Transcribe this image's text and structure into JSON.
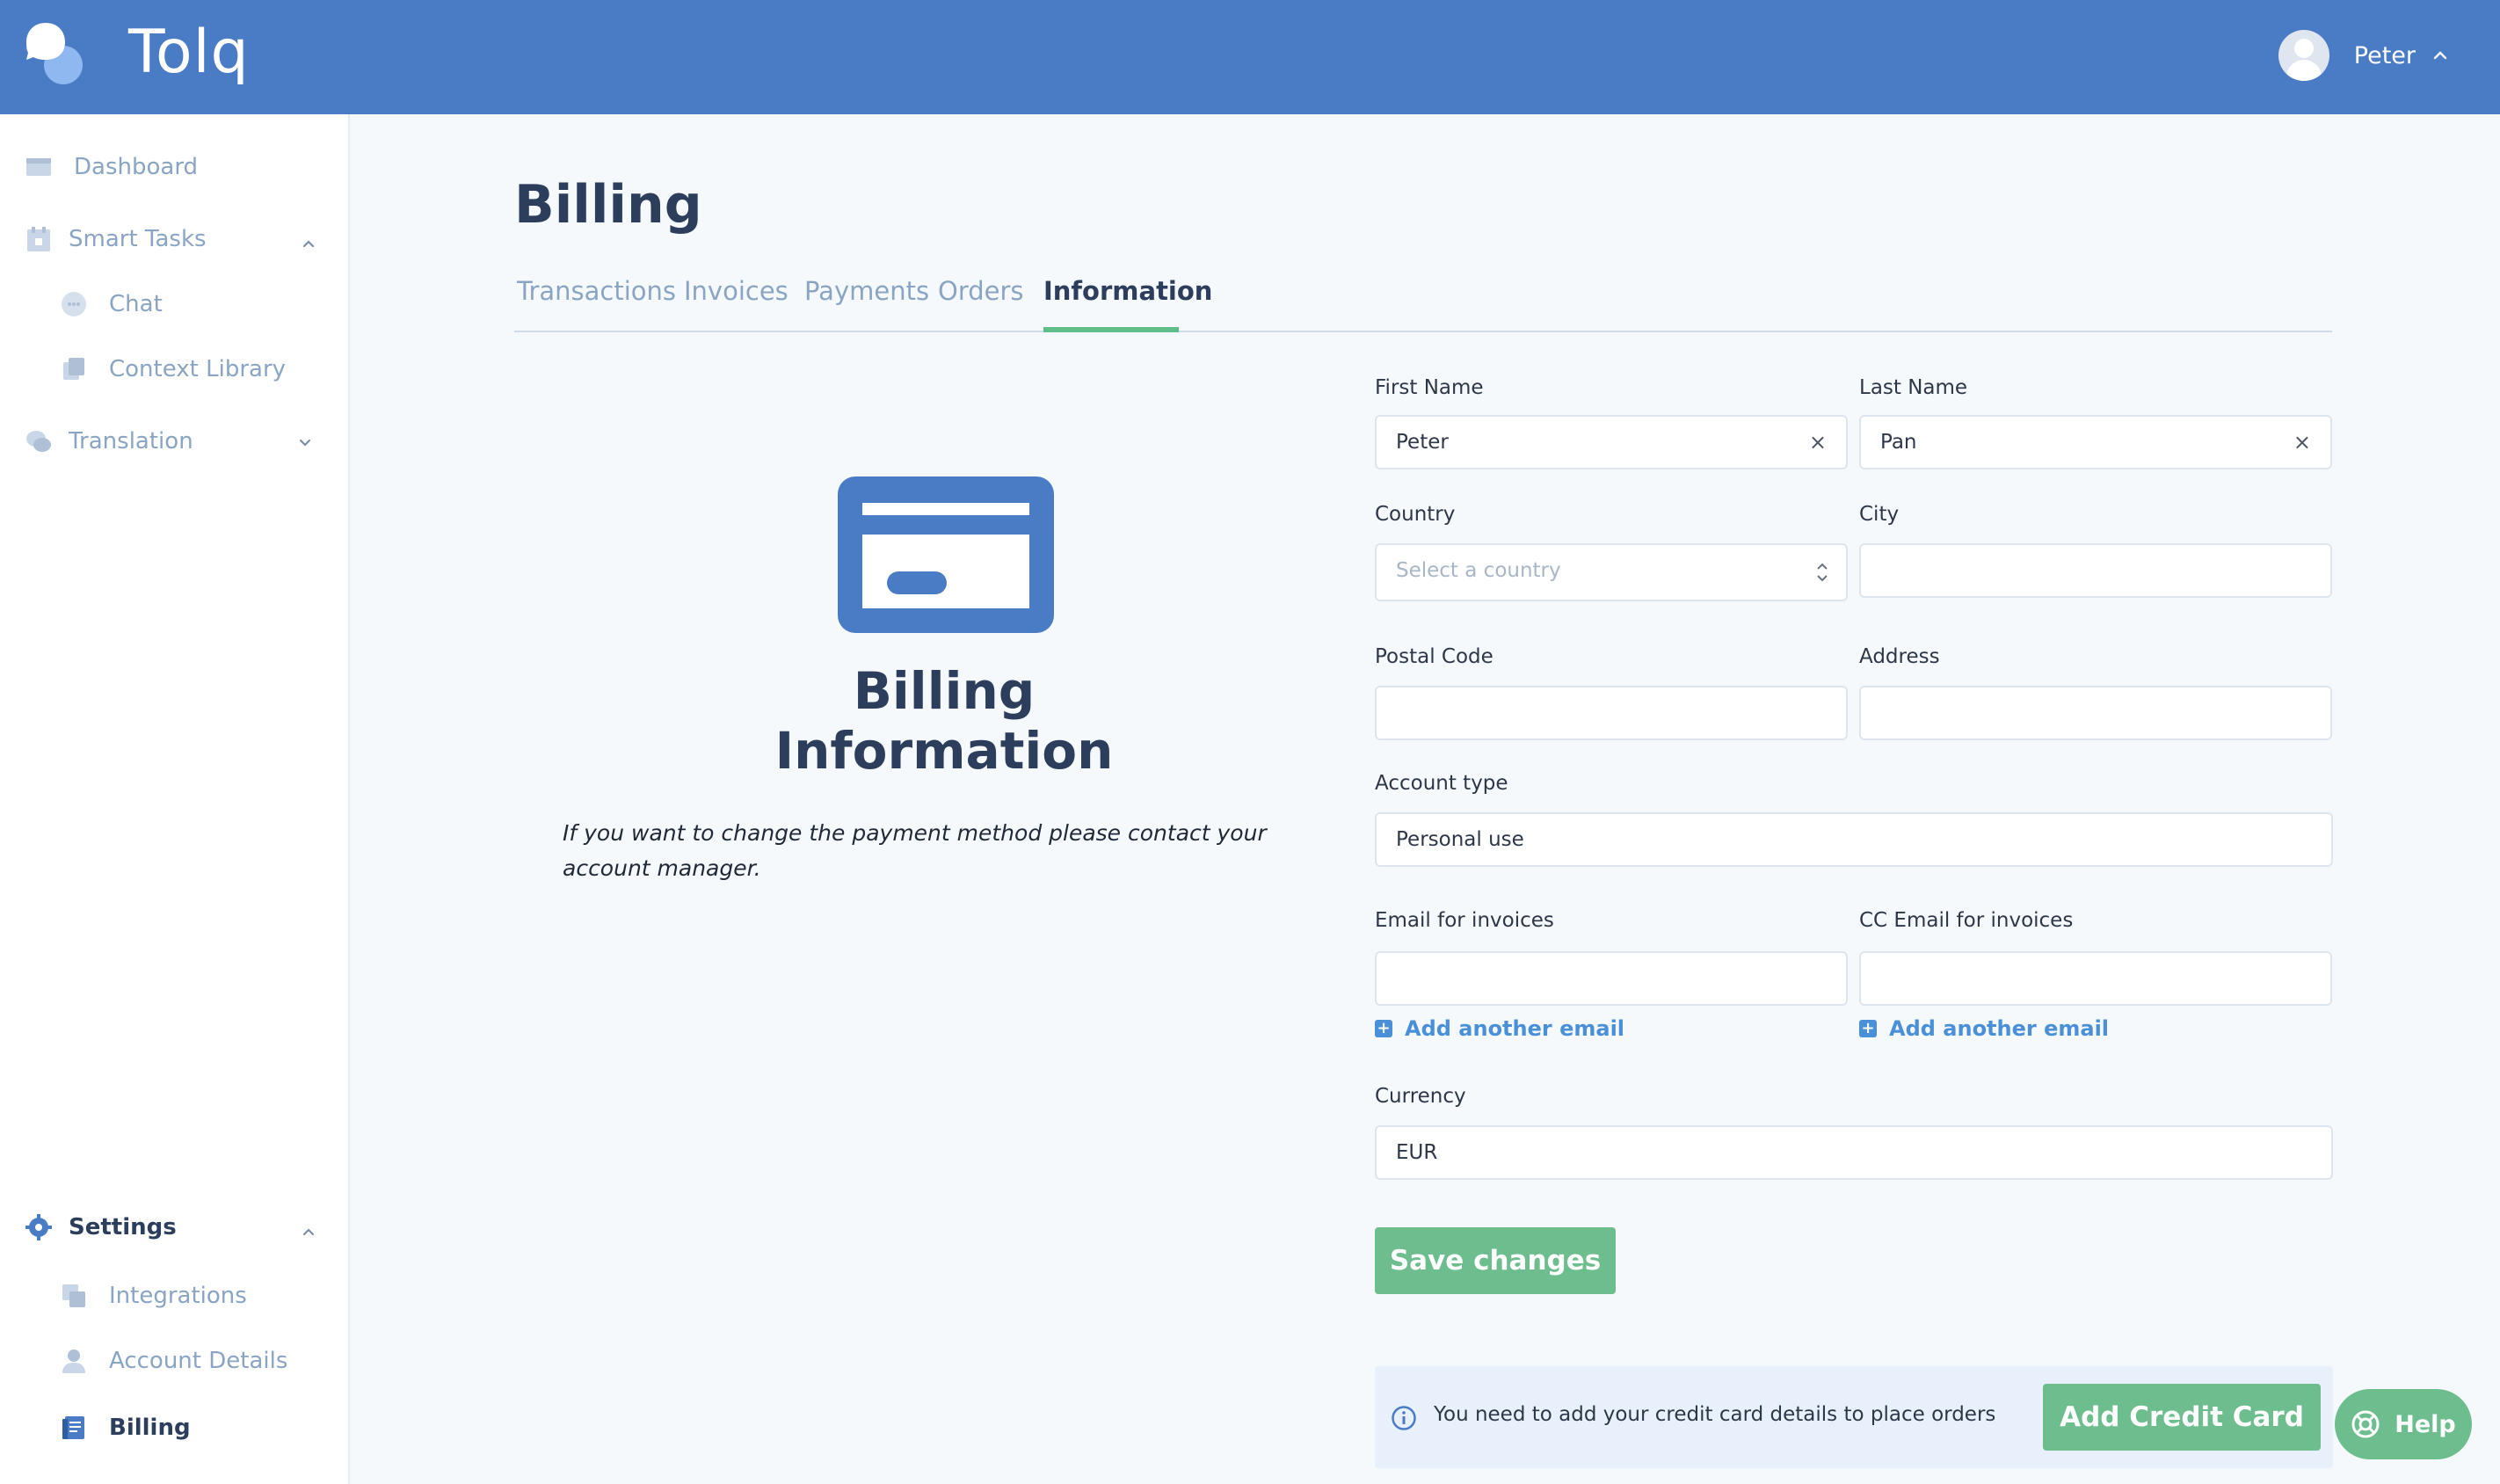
{
  "app": {
    "logo_text": "Tolq"
  },
  "user": {
    "name": "Peter"
  },
  "sidebar": {
    "dashboard": "Dashboard",
    "smart_tasks": "Smart Tasks",
    "chat": "Chat",
    "context_library": "Context Library",
    "translation": "Translation",
    "settings": "Settings",
    "integrations": "Integrations",
    "account_details": "Account Details",
    "billing": "Billing"
  },
  "page": {
    "title": "Billing",
    "tabs": [
      "Transactions",
      "Invoices",
      "Payments",
      "Orders",
      "Information"
    ],
    "active_tab": "Information"
  },
  "info_panel": {
    "heading": "Billing Information",
    "note": "If you want to change the payment method please contact your account manager."
  },
  "form": {
    "first_name_label": "First Name",
    "first_name_value": "Peter",
    "last_name_label": "Last Name",
    "last_name_value": "Pan",
    "country_label": "Country",
    "country_placeholder": "Select a country",
    "city_label": "City",
    "city_value": "",
    "postal_code_label": "Postal Code",
    "postal_code_value": "",
    "address_label": "Address",
    "address_value": "",
    "account_type_label": "Account type",
    "account_type_value": "Personal use",
    "email_label": "Email for invoices",
    "email_value": "",
    "cc_email_label": "CC Email for invoices",
    "cc_email_value": "",
    "add_email_label": "Add another email",
    "add_cc_email_label": "Add another email",
    "currency_label": "Currency",
    "currency_value": "EUR",
    "clear_symbol": "×",
    "save_label": "Save changes"
  },
  "notice": {
    "text": "You need to add your credit card details to place orders",
    "button": "Add Credit Card"
  },
  "help": {
    "label": "Help"
  },
  "colors": {
    "header": "#4a7cc5",
    "accent_green": "#6dbd8e",
    "link_blue": "#4a90d9",
    "title_navy": "#2c3e5c",
    "muted_nav": "#8aa4c4"
  }
}
